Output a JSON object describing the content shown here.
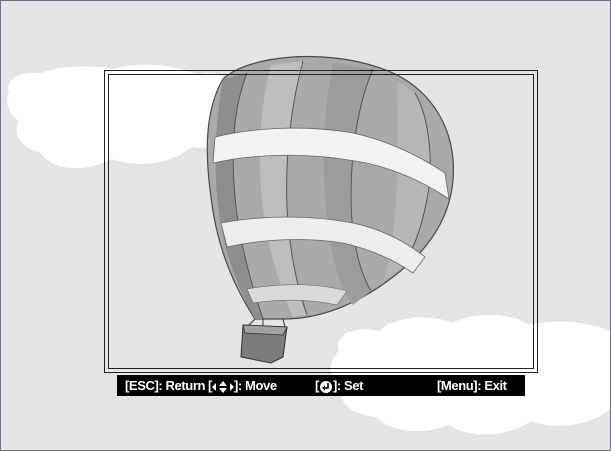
{
  "help_bar": {
    "return": {
      "key": "[ESC]",
      "label": ": Return"
    },
    "move": {
      "key_open": "[",
      "key_close": "]",
      "label": ": Move",
      "icon": "four-way-arrow-icon"
    },
    "set": {
      "key_open": "[",
      "key_close": "]",
      "label": ": Set",
      "icon": "enter-key-icon"
    },
    "exit": {
      "key": "[Menu]",
      "label": ": Exit"
    }
  },
  "colors": {
    "screen_background": "#e4e4e4",
    "clouds": "#ffffff",
    "help_bar_background": "#000000",
    "help_bar_text": "#ffffff"
  }
}
